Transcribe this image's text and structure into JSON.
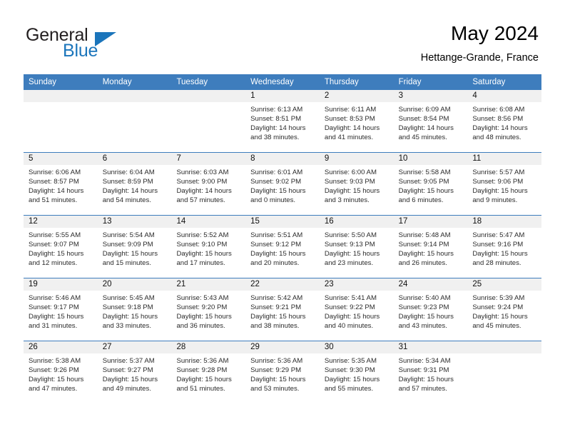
{
  "brand": {
    "word_one": "General",
    "word_two": "Blue",
    "flag_icon": "blue-triangle-flag-icon"
  },
  "header": {
    "title": "May 2024",
    "location": "Hettange-Grande, France"
  },
  "colors": {
    "header_blue": "#3e7dbd",
    "brand_blue": "#1b75bb",
    "daynum_band": "#f0f0f0",
    "text": "#2b2b2b"
  },
  "calendar": {
    "weekdays": [
      "Sunday",
      "Monday",
      "Tuesday",
      "Wednesday",
      "Thursday",
      "Friday",
      "Saturday"
    ],
    "weeks": [
      [
        {
          "day": "",
          "lines": []
        },
        {
          "day": "",
          "lines": []
        },
        {
          "day": "",
          "lines": []
        },
        {
          "day": "1",
          "lines": [
            "Sunrise: 6:13 AM",
            "Sunset: 8:51 PM",
            "Daylight: 14 hours",
            "and 38 minutes."
          ]
        },
        {
          "day": "2",
          "lines": [
            "Sunrise: 6:11 AM",
            "Sunset: 8:53 PM",
            "Daylight: 14 hours",
            "and 41 minutes."
          ]
        },
        {
          "day": "3",
          "lines": [
            "Sunrise: 6:09 AM",
            "Sunset: 8:54 PM",
            "Daylight: 14 hours",
            "and 45 minutes."
          ]
        },
        {
          "day": "4",
          "lines": [
            "Sunrise: 6:08 AM",
            "Sunset: 8:56 PM",
            "Daylight: 14 hours",
            "and 48 minutes."
          ]
        }
      ],
      [
        {
          "day": "5",
          "lines": [
            "Sunrise: 6:06 AM",
            "Sunset: 8:57 PM",
            "Daylight: 14 hours",
            "and 51 minutes."
          ]
        },
        {
          "day": "6",
          "lines": [
            "Sunrise: 6:04 AM",
            "Sunset: 8:59 PM",
            "Daylight: 14 hours",
            "and 54 minutes."
          ]
        },
        {
          "day": "7",
          "lines": [
            "Sunrise: 6:03 AM",
            "Sunset: 9:00 PM",
            "Daylight: 14 hours",
            "and 57 minutes."
          ]
        },
        {
          "day": "8",
          "lines": [
            "Sunrise: 6:01 AM",
            "Sunset: 9:02 PM",
            "Daylight: 15 hours",
            "and 0 minutes."
          ]
        },
        {
          "day": "9",
          "lines": [
            "Sunrise: 6:00 AM",
            "Sunset: 9:03 PM",
            "Daylight: 15 hours",
            "and 3 minutes."
          ]
        },
        {
          "day": "10",
          "lines": [
            "Sunrise: 5:58 AM",
            "Sunset: 9:05 PM",
            "Daylight: 15 hours",
            "and 6 minutes."
          ]
        },
        {
          "day": "11",
          "lines": [
            "Sunrise: 5:57 AM",
            "Sunset: 9:06 PM",
            "Daylight: 15 hours",
            "and 9 minutes."
          ]
        }
      ],
      [
        {
          "day": "12",
          "lines": [
            "Sunrise: 5:55 AM",
            "Sunset: 9:07 PM",
            "Daylight: 15 hours",
            "and 12 minutes."
          ]
        },
        {
          "day": "13",
          "lines": [
            "Sunrise: 5:54 AM",
            "Sunset: 9:09 PM",
            "Daylight: 15 hours",
            "and 15 minutes."
          ]
        },
        {
          "day": "14",
          "lines": [
            "Sunrise: 5:52 AM",
            "Sunset: 9:10 PM",
            "Daylight: 15 hours",
            "and 17 minutes."
          ]
        },
        {
          "day": "15",
          "lines": [
            "Sunrise: 5:51 AM",
            "Sunset: 9:12 PM",
            "Daylight: 15 hours",
            "and 20 minutes."
          ]
        },
        {
          "day": "16",
          "lines": [
            "Sunrise: 5:50 AM",
            "Sunset: 9:13 PM",
            "Daylight: 15 hours",
            "and 23 minutes."
          ]
        },
        {
          "day": "17",
          "lines": [
            "Sunrise: 5:48 AM",
            "Sunset: 9:14 PM",
            "Daylight: 15 hours",
            "and 26 minutes."
          ]
        },
        {
          "day": "18",
          "lines": [
            "Sunrise: 5:47 AM",
            "Sunset: 9:16 PM",
            "Daylight: 15 hours",
            "and 28 minutes."
          ]
        }
      ],
      [
        {
          "day": "19",
          "lines": [
            "Sunrise: 5:46 AM",
            "Sunset: 9:17 PM",
            "Daylight: 15 hours",
            "and 31 minutes."
          ]
        },
        {
          "day": "20",
          "lines": [
            "Sunrise: 5:45 AM",
            "Sunset: 9:18 PM",
            "Daylight: 15 hours",
            "and 33 minutes."
          ]
        },
        {
          "day": "21",
          "lines": [
            "Sunrise: 5:43 AM",
            "Sunset: 9:20 PM",
            "Daylight: 15 hours",
            "and 36 minutes."
          ]
        },
        {
          "day": "22",
          "lines": [
            "Sunrise: 5:42 AM",
            "Sunset: 9:21 PM",
            "Daylight: 15 hours",
            "and 38 minutes."
          ]
        },
        {
          "day": "23",
          "lines": [
            "Sunrise: 5:41 AM",
            "Sunset: 9:22 PM",
            "Daylight: 15 hours",
            "and 40 minutes."
          ]
        },
        {
          "day": "24",
          "lines": [
            "Sunrise: 5:40 AM",
            "Sunset: 9:23 PM",
            "Daylight: 15 hours",
            "and 43 minutes."
          ]
        },
        {
          "day": "25",
          "lines": [
            "Sunrise: 5:39 AM",
            "Sunset: 9:24 PM",
            "Daylight: 15 hours",
            "and 45 minutes."
          ]
        }
      ],
      [
        {
          "day": "26",
          "lines": [
            "Sunrise: 5:38 AM",
            "Sunset: 9:26 PM",
            "Daylight: 15 hours",
            "and 47 minutes."
          ]
        },
        {
          "day": "27",
          "lines": [
            "Sunrise: 5:37 AM",
            "Sunset: 9:27 PM",
            "Daylight: 15 hours",
            "and 49 minutes."
          ]
        },
        {
          "day": "28",
          "lines": [
            "Sunrise: 5:36 AM",
            "Sunset: 9:28 PM",
            "Daylight: 15 hours",
            "and 51 minutes."
          ]
        },
        {
          "day": "29",
          "lines": [
            "Sunrise: 5:36 AM",
            "Sunset: 9:29 PM",
            "Daylight: 15 hours",
            "and 53 minutes."
          ]
        },
        {
          "day": "30",
          "lines": [
            "Sunrise: 5:35 AM",
            "Sunset: 9:30 PM",
            "Daylight: 15 hours",
            "and 55 minutes."
          ]
        },
        {
          "day": "31",
          "lines": [
            "Sunrise: 5:34 AM",
            "Sunset: 9:31 PM",
            "Daylight: 15 hours",
            "and 57 minutes."
          ]
        },
        {
          "day": "",
          "lines": []
        }
      ]
    ]
  }
}
